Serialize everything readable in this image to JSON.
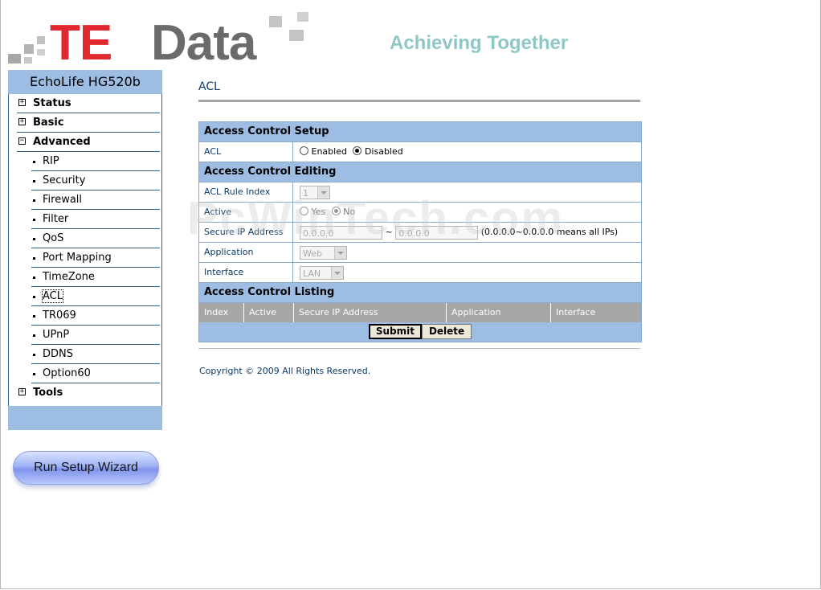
{
  "brand": {
    "logo_te": "TE",
    "logo_data": "Data",
    "tagline": "Achieving Together"
  },
  "sidebar": {
    "model": "EchoLife HG520b",
    "groups": [
      {
        "label": "Status",
        "expander": "+"
      },
      {
        "label": "Basic",
        "expander": "+"
      },
      {
        "label": "Advanced",
        "expander": "−"
      }
    ],
    "advanced_items": [
      "RIP",
      "Security",
      "Firewall",
      "Filter",
      "QoS",
      "Port Mapping",
      "TimeZone",
      "ACL",
      "TR069",
      "UPnP",
      "DDNS",
      "Option60"
    ],
    "active_item": "ACL",
    "tools": {
      "label": "Tools",
      "expander": "+"
    },
    "wizard_label": "Run Setup Wizard"
  },
  "page": {
    "title": "ACL",
    "setup": {
      "header": "Access Control Setup",
      "acl_label": "ACL",
      "enabled_label": "Enabled",
      "disabled_label": "Disabled",
      "selected": "Disabled"
    },
    "editing": {
      "header": "Access Control Editing",
      "rule_index_label": "ACL Rule Index",
      "rule_index_value": "1",
      "active_label": "Active",
      "yes_label": "Yes",
      "no_label": "No",
      "active_selected": "No",
      "secure_ip_label": "Secure IP Address",
      "ip_from": "0.0.0.0",
      "ip_tilde": "~",
      "ip_to": "0.0.0.0",
      "ip_hint": "(0.0.0.0~0.0.0.0 means all IPs)",
      "application_label": "Application",
      "application_value": "Web",
      "interface_label": "Interface",
      "interface_value": "LAN"
    },
    "listing": {
      "header": "Access Control Listing",
      "columns": [
        "Index",
        "Active",
        "Secure IP Address",
        "Application",
        "Interface"
      ]
    },
    "buttons": {
      "submit": "Submit",
      "delete": "Delete"
    },
    "copyright": "Copyright © 2009 All Rights Reserved.",
    "watermark": "PcWinTech.com"
  },
  "colors": {
    "accent_blue": "#9dbde3",
    "te_red": "#e0282e",
    "data_grey": "#6b6b6b",
    "tagline_teal": "#8fc7c6"
  }
}
